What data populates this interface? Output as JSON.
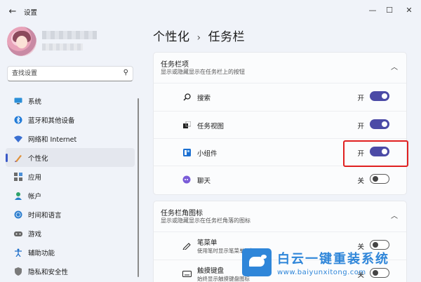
{
  "window": {
    "title": "设置",
    "back_icon": "back-arrow-icon",
    "minimize": "—",
    "maximize": "☐",
    "close": "✕"
  },
  "search": {
    "placeholder": "查找设置"
  },
  "sidebar": {
    "items": [
      {
        "label": "系统",
        "icon": "system-icon"
      },
      {
        "label": "蓝牙和其他设备",
        "icon": "bluetooth-icon"
      },
      {
        "label": "网络和 Internet",
        "icon": "network-icon"
      },
      {
        "label": "个性化",
        "icon": "personalization-icon",
        "active": true
      },
      {
        "label": "应用",
        "icon": "apps-icon"
      },
      {
        "label": "帐户",
        "icon": "account-icon"
      },
      {
        "label": "时间和语言",
        "icon": "time-language-icon"
      },
      {
        "label": "游戏",
        "icon": "gaming-icon"
      },
      {
        "label": "辅助功能",
        "icon": "accessibility-icon"
      },
      {
        "label": "隐私和安全性",
        "icon": "privacy-icon"
      }
    ]
  },
  "breadcrumb": {
    "parent": "个性化",
    "separator": "›",
    "current": "任务栏"
  },
  "taskbar_items": {
    "title": "任务栏项",
    "description": "显示或隐藏显示在任务栏上的按钮",
    "rows": [
      {
        "label": "搜索",
        "state": "开",
        "on": true,
        "icon": "search-icon"
      },
      {
        "label": "任务视图",
        "state": "开",
        "on": true,
        "icon": "task-view-icon"
      },
      {
        "label": "小组件",
        "state": "开",
        "on": true,
        "icon": "widgets-icon"
      },
      {
        "label": "聊天",
        "state": "关",
        "on": false,
        "icon": "chat-icon"
      }
    ]
  },
  "corner_icons": {
    "title": "任务栏角图标",
    "description": "显示或隐藏显示在任务栏角落的图标",
    "rows": [
      {
        "label": "笔菜单",
        "sub": "使用笔时显示笔菜单图标",
        "state": "关",
        "on": false,
        "icon": "pen-icon"
      },
      {
        "label": "触摸键盘",
        "sub": "始终显示触摸键盘图标",
        "state": "关",
        "on": false,
        "icon": "keyboard-icon"
      }
    ]
  },
  "watermark": {
    "title": "白云一键重装系统",
    "url": "www.baiyunxitong.com"
  },
  "colors": {
    "accent": "#4b4aa6",
    "highlight": "#e02020",
    "nav_marker": "#3a59c8"
  }
}
